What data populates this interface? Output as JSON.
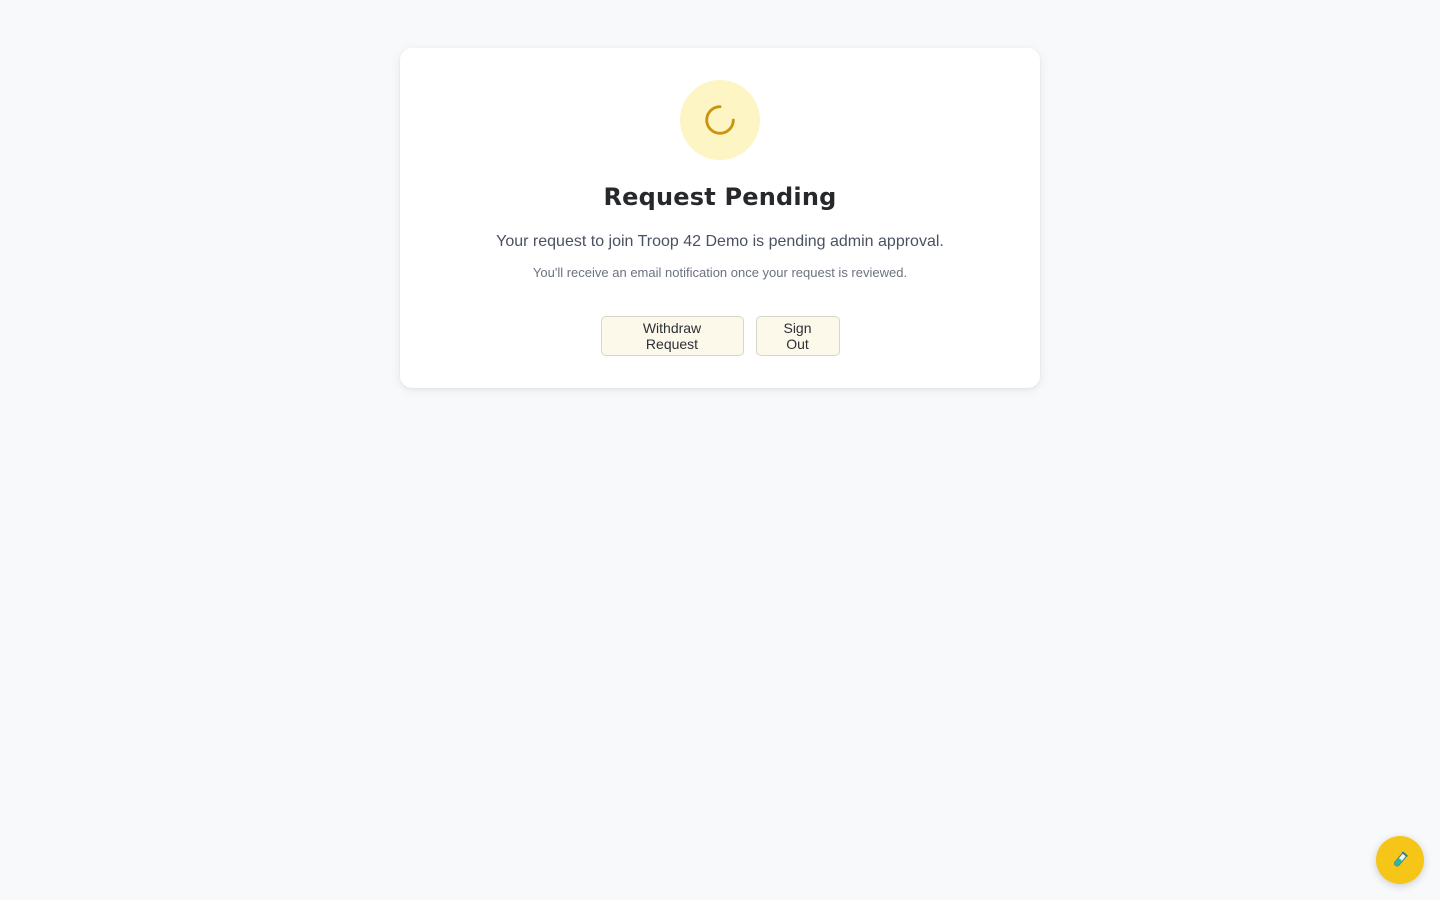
{
  "status": {
    "icon": "loader-icon",
    "accent_color": "#c9950a",
    "circle_color": "#fdf5c4"
  },
  "card": {
    "title": "Request Pending",
    "message": "Your request to join Troop 42 Demo is pending admin approval.",
    "subtext": "You'll receive an email notification once your request is reviewed."
  },
  "actions": {
    "withdraw_label": "Withdraw Request",
    "signout_label": "Sign Out"
  },
  "fab": {
    "icon": "test-tube-icon",
    "color": "#f5c518"
  }
}
